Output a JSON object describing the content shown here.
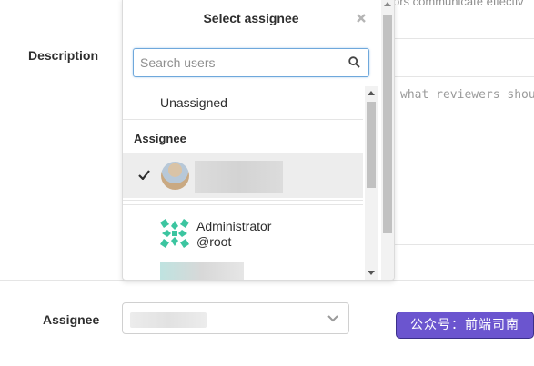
{
  "form": {
    "description_label": "Description",
    "assignee_label": "Assignee",
    "top_hint_text": "ors communicate effectiv",
    "description_placeholder_fragment": "what reviewers shou"
  },
  "dropdown": {
    "title": "Select assignee",
    "search_placeholder": "Search users",
    "unassigned_label": "Unassigned",
    "section_header": "Assignee",
    "users": [
      {
        "name": "Administrator",
        "username": "@root"
      }
    ]
  },
  "watermark": {
    "text": "公众号：前端司南"
  },
  "icons": {
    "close": "close-icon",
    "search": "search-icon",
    "check": "check-icon",
    "chevron": "chevron-down-icon"
  },
  "colors": {
    "accent_border": "#6fa8dc",
    "selected_row": "#ededed",
    "identicon": "#3cc5a0",
    "watermark_bg": "#6b55cf"
  }
}
